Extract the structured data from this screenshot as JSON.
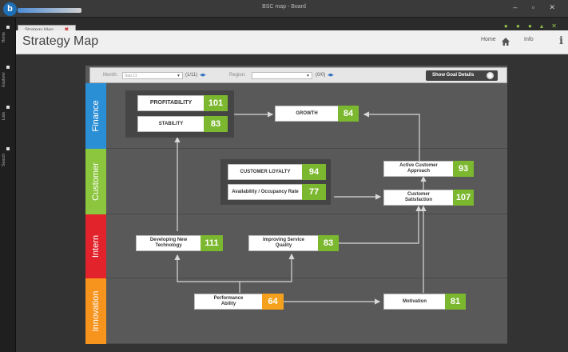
{
  "window": {
    "title": "BSC map - Board"
  },
  "tabs": [
    {
      "label": "Strategy Map"
    }
  ],
  "sidebar": {
    "items": [
      "Home",
      "Explorer",
      "Lists",
      "Search"
    ]
  },
  "header": {
    "title": "Strategy Map",
    "home_label": "Home",
    "info_label": "Info"
  },
  "filters": {
    "month_label": "Month:",
    "month_value": "Sep.11",
    "month_count": "(1/11)",
    "region_label": "Region:",
    "region_value": "",
    "region_count": "(0/0)",
    "show_details_label": "Show Goal Details"
  },
  "lanes": [
    {
      "label": "Finance",
      "color": "#2b8fd6"
    },
    {
      "label": "Customer",
      "color": "#8cc63f"
    },
    {
      "label": "Intern",
      "color": "#e3232c"
    },
    {
      "label": "Innovation",
      "color": "#f7941d"
    }
  ],
  "objectives": {
    "profitability": {
      "label": "PROFITABILITY",
      "score": "101",
      "status": "green"
    },
    "stability": {
      "label": "STABILITY",
      "score": "83",
      "status": "green"
    },
    "growth": {
      "label": "GROWTH",
      "score": "84",
      "status": "green"
    },
    "customer_loyalty": {
      "label": "CUSTOMER LOYALTY",
      "score": "94",
      "status": "green"
    },
    "availability": {
      "label": "Availability / Occupancy Rate",
      "score": "77",
      "status": "green"
    },
    "active_customer": {
      "label": "Active Customer Approach",
      "score": "93",
      "status": "green"
    },
    "customer_satisfaction": {
      "label": "Customer Satisfaction",
      "score": "107",
      "status": "green"
    },
    "developing_tech": {
      "label": "Developing New Technology",
      "score": "111",
      "status": "green"
    },
    "improving_service": {
      "label": "Improving Service Quality",
      "score": "83",
      "status": "green"
    },
    "performance": {
      "label": "Performance Ability",
      "score": "64",
      "status": "orange"
    },
    "motivation": {
      "label": "Motivation",
      "score": "81",
      "status": "green"
    }
  }
}
